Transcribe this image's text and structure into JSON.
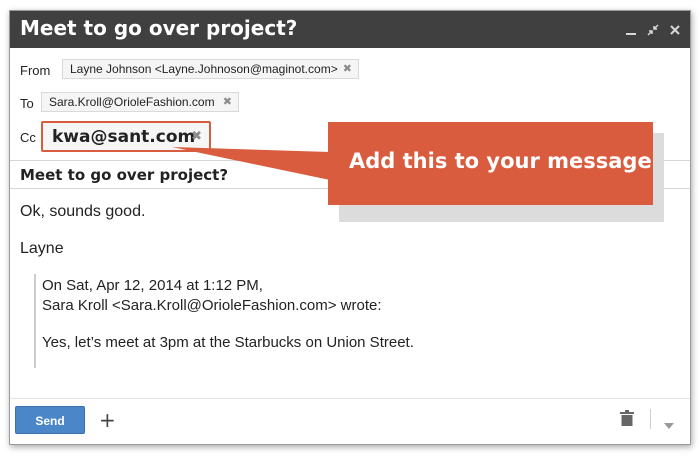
{
  "window": {
    "title": "Meet to go over project?",
    "titlebar_color": "#404040"
  },
  "fields": {
    "from_label": "From",
    "from_value": "Layne Johnson <Layne.Johnoson@maginot.com>",
    "to_label": "To",
    "to_value": "Sara.Kroll@OrioleFashion.com",
    "cc_label": "Cc",
    "cc_value": "kwa@sant.com"
  },
  "subject": "Meet to go over project?",
  "body": {
    "line1": "Ok, sounds good.",
    "signature": "Layne",
    "quote_header_1": "On Sat, Apr 12, 2014 at 1:12 PM,",
    "quote_header_2": "Sara Kroll <Sara.Kroll@OrioleFashion.com> wrote:",
    "quote_text": "Yes, let’s meet at 3pm at the Starbucks on Union Street."
  },
  "footer": {
    "send_label": "Send",
    "plus_label": "+",
    "send_color": "#4a86c8"
  },
  "callout": {
    "text": "Add this to your message",
    "color": "#d95c3e"
  },
  "icons": {
    "chip_remove": "✖",
    "minimize": "minimize-icon",
    "expand": "expand-icon",
    "close": "close-icon",
    "trash": "trash-icon",
    "more": "chevron-down-icon"
  }
}
